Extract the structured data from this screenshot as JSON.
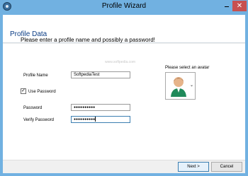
{
  "window": {
    "title": "Profile Wizard",
    "close_glyph": "✕"
  },
  "header": {
    "section_title": "Profile Data"
  },
  "main": {
    "intro": "Please enter a profile name and possibly a password!",
    "watermark": "www.softpedia.com",
    "profile_name_label": "Profile Name",
    "profile_name_value": "SoftpediaTest",
    "use_password_label": "Use Password",
    "use_password_checked": true,
    "check_glyph": "✓",
    "password_label": "Password",
    "password_value": "●●●●●●●●●●",
    "verify_password_label": "Verify Password",
    "verify_password_value": "●●●●●●●●●●",
    "avatar_label": "Please select an avatar",
    "avatar_chevron": "⌄"
  },
  "footer": {
    "next_label": "Next >",
    "cancel_label": "Cancel"
  },
  "colors": {
    "title_bar": "#71b1e1",
    "section_title": "#0b3d85",
    "close_button": "#c75050"
  }
}
